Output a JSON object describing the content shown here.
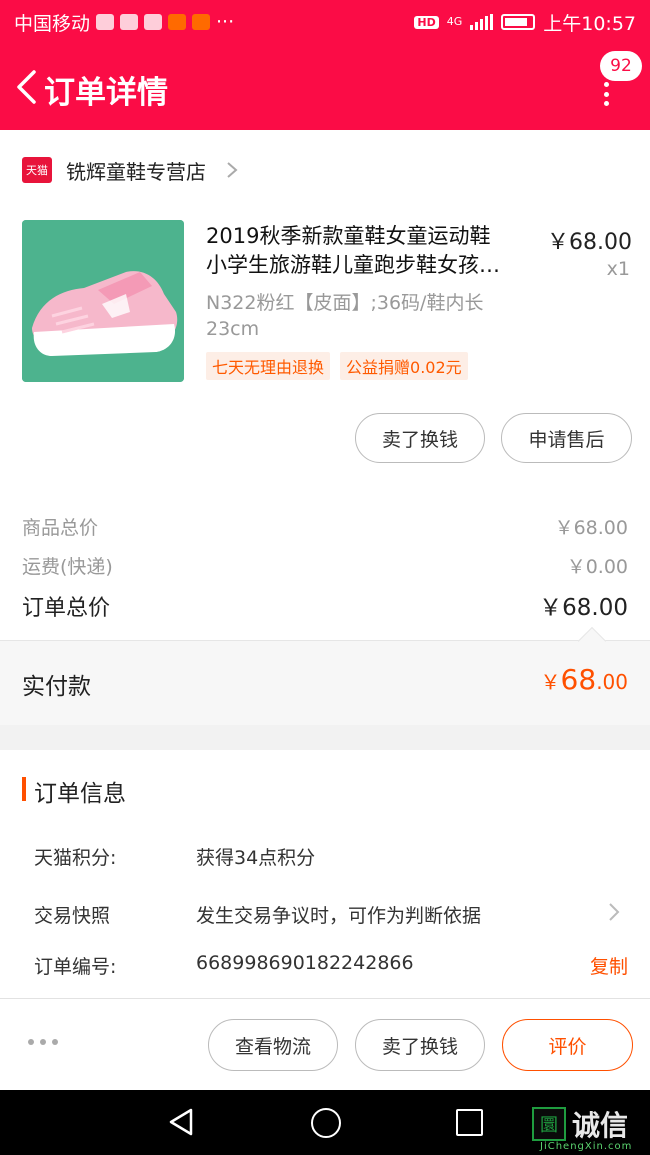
{
  "status_bar": {
    "carrier": "中国移动",
    "signal": "4G",
    "hd": "HD",
    "time": "上午10:57"
  },
  "header": {
    "title": "订单详情",
    "badge_count": "92"
  },
  "shop": {
    "logo_text": "天猫",
    "name": "铣辉童鞋专营店"
  },
  "product": {
    "title_line1": "2019秋季新款童鞋女童运动鞋",
    "title_line2": "小学生旅游鞋儿童跑步鞋女孩…",
    "price": "￥68.00",
    "quantity": "x1",
    "sku": "N322粉红【皮面】;36码/鞋内长23cm",
    "tags": [
      "七天无理由退换",
      "公益捐赠0.02元"
    ],
    "actions": [
      "卖了换钱",
      "申请售后"
    ]
  },
  "summary": {
    "goods_total_label": "商品总价",
    "goods_total_value": "￥68.00",
    "shipping_label": "运费(快递)",
    "shipping_value": "￥0.00",
    "order_total_label": "订单总价",
    "order_total_value": "￥68.00",
    "paid_label": "实付款",
    "paid_currency": "￥",
    "paid_integer": "68",
    "paid_decimal": ".00"
  },
  "order_info": {
    "section_title": "订单信息",
    "points_label": "天猫积分:",
    "points_value": "获得34点积分",
    "snapshot_label": "交易快照",
    "snapshot_value": "发生交易争议时，可作为判断依据",
    "order_no_label": "订单编号:",
    "order_no_value": "668998690182242866",
    "copy_label": "复制"
  },
  "action_bar": {
    "buttons": [
      "查看物流",
      "卖了换钱",
      "评价"
    ]
  },
  "watermark": {
    "text": "诚信",
    "mark": "圜",
    "sub": "JiChengXin.com"
  },
  "colors": {
    "brand": "#fb0c46",
    "accent": "#ff5000"
  }
}
